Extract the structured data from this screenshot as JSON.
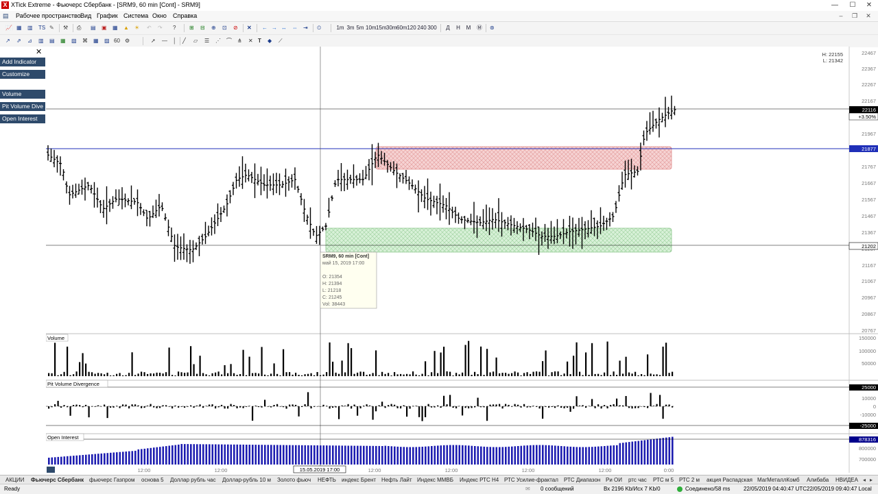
{
  "window": {
    "title": "XTick Extreme - Фьючерс Сбербанк - [SRM9, 60 min [Cont] - SRM9]",
    "minimize_label": "—",
    "maximize_label": "☐",
    "close_label": "✕"
  },
  "menu": {
    "items": [
      "Рабочее пространство",
      "Вид",
      "График",
      "Система",
      "Окно",
      "Справка"
    ],
    "mdi_min": "–",
    "mdi_restore": "❐",
    "mdi_close": "✕"
  },
  "toolbar": {
    "timeframes": [
      "1m",
      "3m",
      "5m",
      "10m",
      "15m",
      "30m",
      "60m",
      "120",
      "240",
      "300"
    ],
    "periods": [
      "Д",
      "Н",
      "М"
    ]
  },
  "left_panel": {
    "close_label": "✕",
    "buttons": [
      "Add Indicator",
      "Customize"
    ],
    "indicators": [
      "Volume",
      "Pit Volume Dive",
      "Open Interest"
    ]
  },
  "chart": {
    "hl_box": {
      "h": "H: 22155",
      "l": "L: 21342"
    },
    "price_axis": [
      "22467",
      "22367",
      "22267",
      "22167",
      "22067",
      "21967",
      "21867",
      "21767",
      "21667",
      "21567",
      "21467",
      "21367",
      "21267",
      "21167",
      "21067",
      "20967",
      "20867",
      "20767"
    ],
    "labels": {
      "last_price": "22116",
      "change": "+3.50%",
      "blue_line": "21877",
      "lower_line": "21202"
    },
    "tooltip": {
      "title": "SRM9, 60 min [Cont]",
      "date": "май 15, 2019 17:00",
      "o": "O: 21354",
      "h": "H: 21394",
      "l": "L: 21218",
      "c": "C: 21245",
      "vol": "Vol: 38443"
    },
    "cursor_date": "15.05.2019   17:00",
    "time_labels": [
      "12:00",
      "12:00",
      "12:00",
      "12:00",
      "12:00",
      "12:00",
      "0:00"
    ],
    "volume": {
      "title": "Volume",
      "axis": [
        "150000",
        "100000",
        "50000"
      ]
    },
    "pvd": {
      "title": "Pit Volume Divergence",
      "axis_top": "25000",
      "axis": [
        "10000",
        "0",
        "-10000"
      ],
      "axis_bottom": "-25000"
    },
    "oi": {
      "title": "Open Interest",
      "axis_top": "878316",
      "axis": [
        "800000",
        "700000"
      ]
    },
    "colors": {
      "resistance_zone": "#f3c5c5",
      "support_zone": "#cdeccd",
      "blue_line": "#1f2fb8",
      "oi_bars": "#1c1cb0",
      "axis_tag": "#00008b"
    }
  },
  "tabs": [
    "АКЦИИ",
    "Фьючерс Сбербанк",
    "фьючерс Газпром",
    "основа 5",
    "Доллар рубль час",
    "Доллар-рубль 10 м",
    "Золото фьюч",
    "НЕФТЬ",
    "индекс Брент",
    "Нефть Лайт",
    "Индекс ММВБ",
    "Индекс РТС Н4",
    "РТС Усилие-фрактал",
    "РТС Диапазон",
    "Ри ОИ",
    "ртс час",
    "РТС м 5",
    "РТС 2 м",
    "акция Распадская",
    "МагМеталлКомб",
    "Алибаба",
    "НВИДЕА"
  ],
  "status": {
    "ready": "Ready",
    "messages": "0 сообщений",
    "traffic": "Вх 2196 Kb/Исх 7 Kb/0",
    "connection": "Соединено/58 ms",
    "time_utc": "22/05/2019 04:40:47 UTC",
    "time_local": "22/05/2019 09:40:47 Local"
  }
}
